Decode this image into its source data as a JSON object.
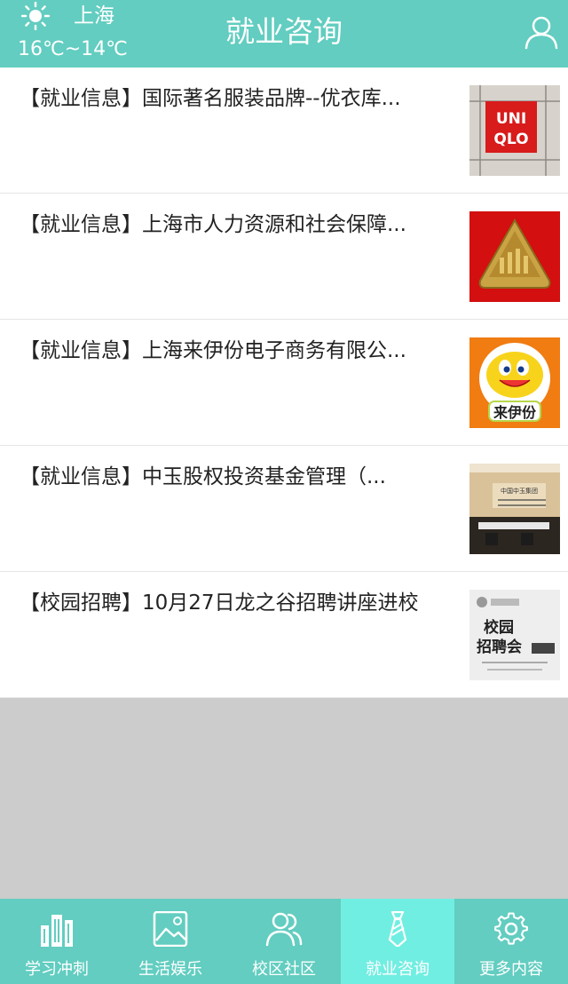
{
  "header": {
    "city": "上海",
    "temperature": "16℃~14℃",
    "title": "就业咨询",
    "weather_icon": "sun-icon",
    "user_icon": "user-icon"
  },
  "news": [
    {
      "title": "【就业信息】国际著名服装品牌--优衣库...",
      "thumb": {
        "text_line1": "UNI",
        "text_line2": "QLO"
      }
    },
    {
      "title": "【就业信息】上海市人力资源和社会保障...",
      "thumb": {}
    },
    {
      "title": "【就业信息】上海来伊份电子商务有限公...",
      "thumb": {
        "text": "来伊份"
      }
    },
    {
      "title": "【就业信息】中玉股权投资基金管理（...",
      "thumb": {
        "text": "中国中玉集团"
      }
    },
    {
      "title": "【校园招聘】10月27日龙之谷招聘讲座进校",
      "thumb": {
        "text_line1": "校园",
        "text_line2": "招聘会"
      }
    }
  ],
  "tabs": [
    {
      "label": "学习冲刺",
      "icon": "buildings-icon",
      "active": false
    },
    {
      "label": "生活娱乐",
      "icon": "picture-icon",
      "active": false
    },
    {
      "label": "校区社区",
      "icon": "users-icon",
      "active": false
    },
    {
      "label": "就业咨询",
      "icon": "tie-icon",
      "active": true
    },
    {
      "label": "更多内容",
      "icon": "gear-icon",
      "active": false
    }
  ],
  "colors": {
    "primary": "#62cdc0",
    "active_tab": "#71eee2",
    "background": "#cccccc"
  }
}
